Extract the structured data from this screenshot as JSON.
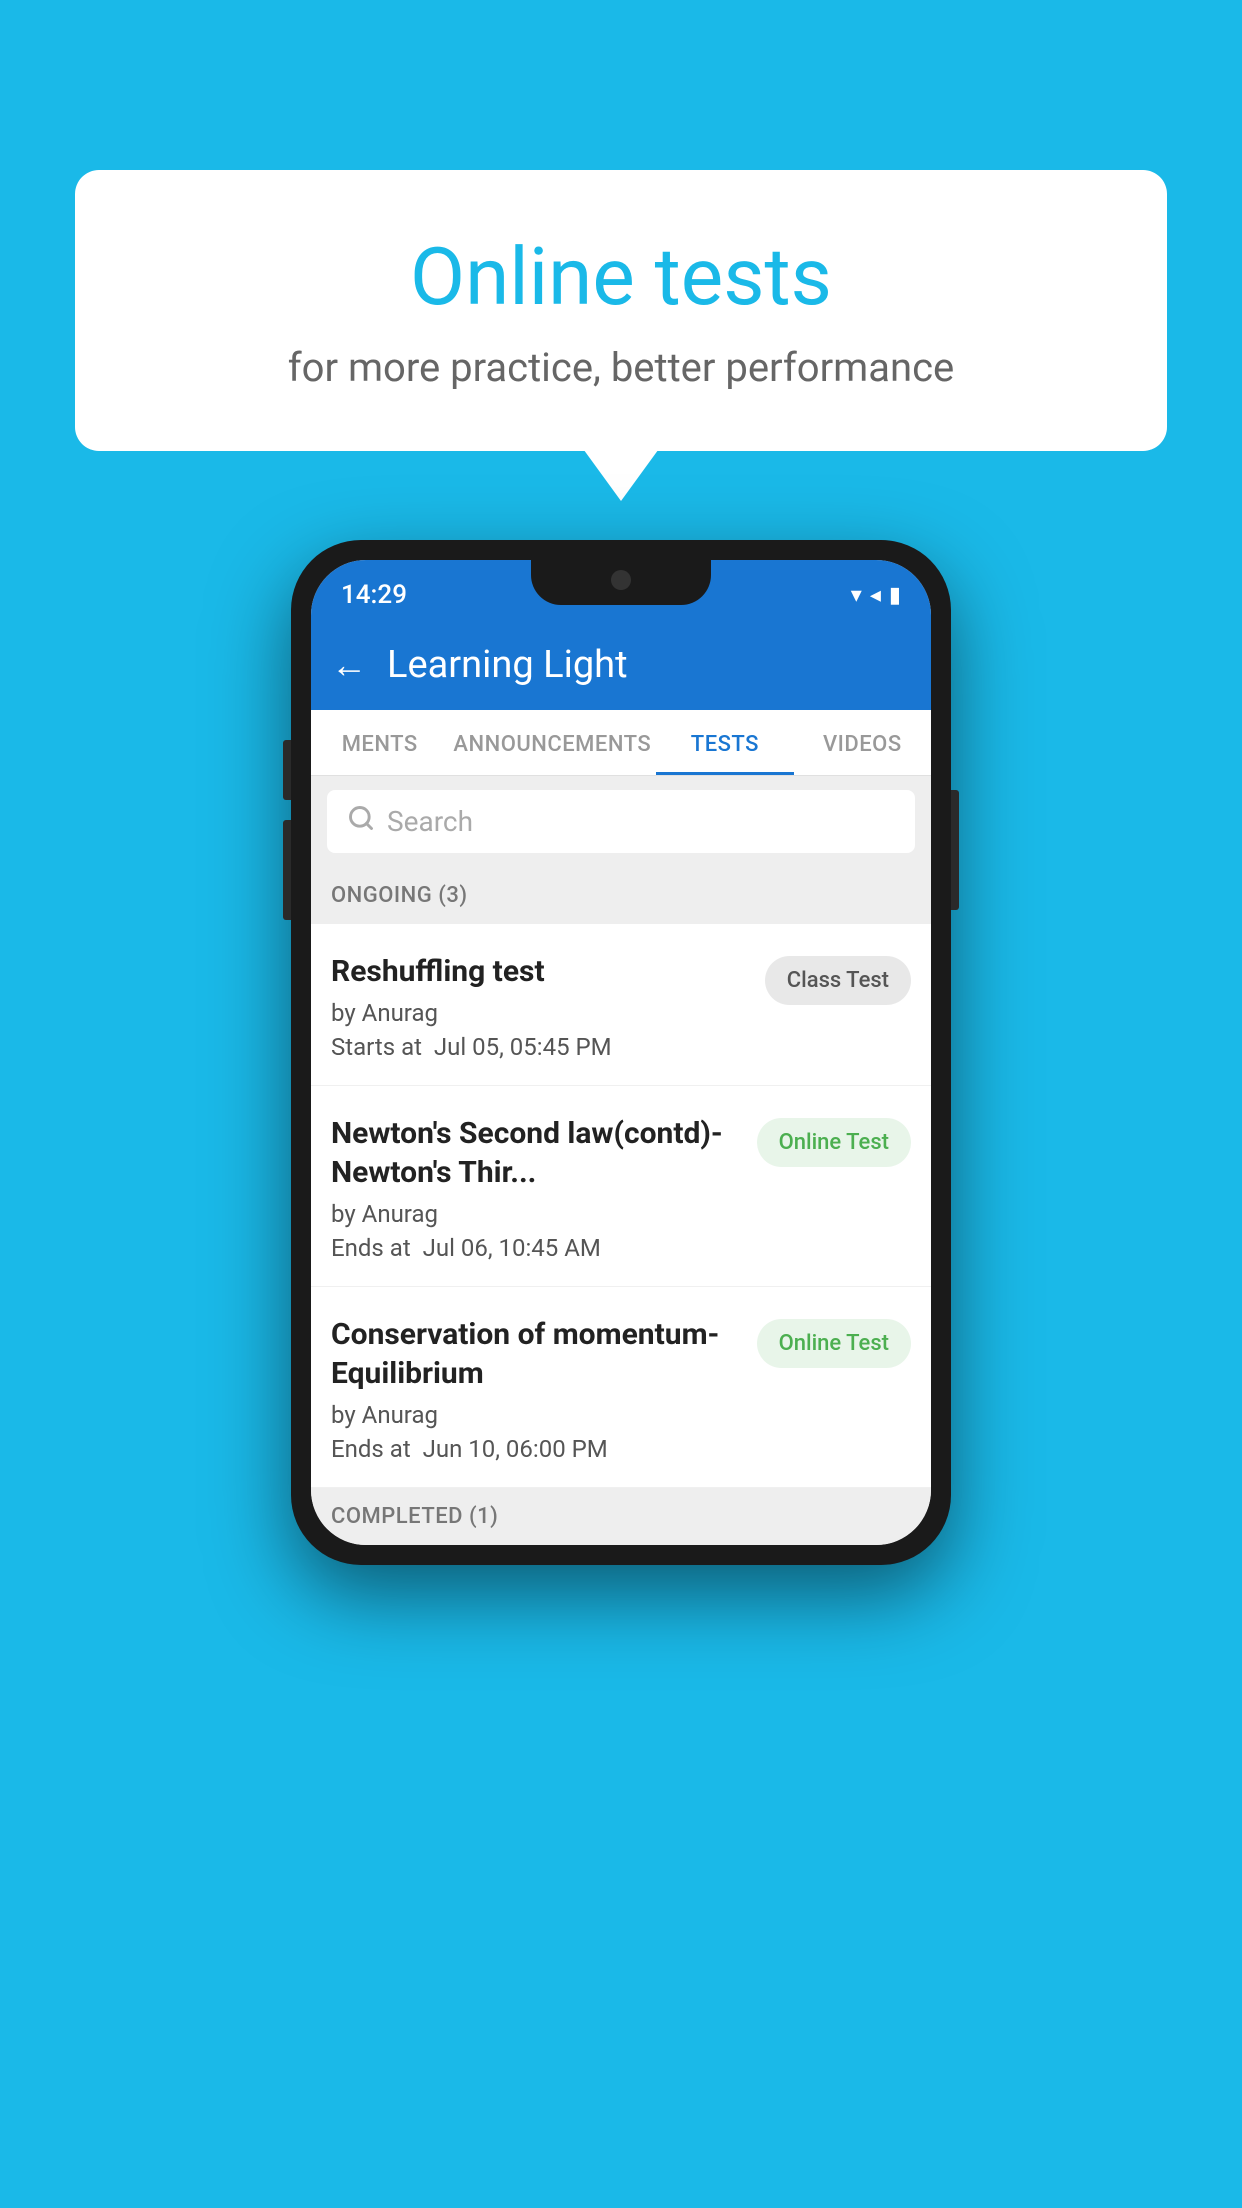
{
  "background": {
    "color": "#1ab9e8"
  },
  "speech_bubble": {
    "title": "Online tests",
    "subtitle": "for more practice, better performance"
  },
  "app": {
    "header_title": "Learning Light",
    "back_label": "←"
  },
  "status_bar": {
    "time": "14:29",
    "wifi_icon": "▼",
    "signal_icon": "▲",
    "battery_icon": "▋"
  },
  "tabs": [
    {
      "label": "MENTS",
      "active": false
    },
    {
      "label": "ANNOUNCEMENTS",
      "active": false
    },
    {
      "label": "TESTS",
      "active": true
    },
    {
      "label": "VIDEOS",
      "active": false
    }
  ],
  "search": {
    "placeholder": "Search"
  },
  "ongoing_section": {
    "title": "ONGOING (3)"
  },
  "test_items": [
    {
      "name": "Reshuffling test",
      "by": "by Anurag",
      "date_label": "Starts at",
      "date": "Jul 05, 05:45 PM",
      "badge": "Class Test",
      "badge_type": "class"
    },
    {
      "name": "Newton's Second law(contd)-Newton's Thir...",
      "by": "by Anurag",
      "date_label": "Ends at",
      "date": "Jul 06, 10:45 AM",
      "badge": "Online Test",
      "badge_type": "online"
    },
    {
      "name": "Conservation of momentum-Equilibrium",
      "by": "by Anurag",
      "date_label": "Ends at",
      "date": "Jun 10, 06:00 PM",
      "badge": "Online Test",
      "badge_type": "online"
    }
  ],
  "completed_section": {
    "title": "COMPLETED (1)"
  }
}
